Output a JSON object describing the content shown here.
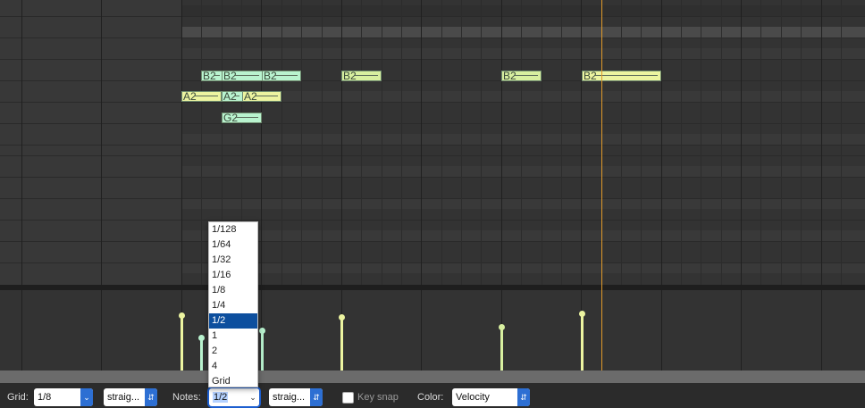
{
  "notes": [
    {
      "label": "B2",
      "color": "mint"
    },
    {
      "label": "B2",
      "color": "mint"
    },
    {
      "label": "B2",
      "color": "mint"
    },
    {
      "label": "B2",
      "color": "lime"
    },
    {
      "label": "B2",
      "color": "lime"
    },
    {
      "label": "B2",
      "color": "yellow"
    },
    {
      "label": "A2",
      "color": "yellow"
    },
    {
      "label": "A2",
      "color": "mint"
    },
    {
      "label": "A2",
      "color": "yellow"
    },
    {
      "label": "G2",
      "color": "mint"
    }
  ],
  "toolbar": {
    "grid_label": "Grid:",
    "grid_value": "1/8",
    "grid_swing_value": "straig...",
    "notes_label": "Notes:",
    "notes_value": "1/2",
    "notes_swing_value": "straig...",
    "keysnap_label": "Key snap",
    "color_label": "Color:",
    "color_value": "Velocity"
  },
  "dropdown": {
    "options": [
      "1/128",
      "1/64",
      "1/32",
      "1/16",
      "1/8",
      "1/4",
      "1/2",
      "1",
      "2",
      "4",
      "Grid"
    ],
    "selected": "1/2"
  },
  "colors": {
    "playhead": "#e09a2a",
    "note_mint": "#b9f3cf",
    "note_lime": "#d8f0a0",
    "note_yellow": "#ecf4a0",
    "accent": "#2d6fd3",
    "dropdown_selected": "#0d4f9e"
  }
}
